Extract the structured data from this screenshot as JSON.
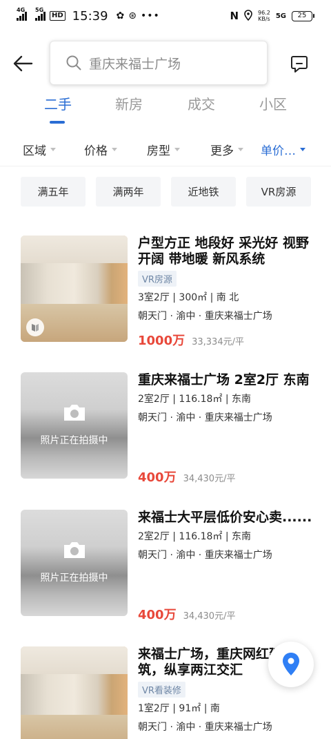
{
  "status_bar": {
    "sig1_tag": "4G",
    "sig2_tag": "5G",
    "hd": "HD",
    "time": "15:39",
    "net_speed": "96.2",
    "net_unit": "KB/s",
    "sig3_tag": "5G",
    "battery": "25"
  },
  "search": {
    "placeholder": "重庆来福士广场"
  },
  "tabs": [
    {
      "label": "二手",
      "active": true
    },
    {
      "label": "新房"
    },
    {
      "label": "成交"
    },
    {
      "label": "小区"
    }
  ],
  "filters": [
    {
      "label": "区域"
    },
    {
      "label": "价格"
    },
    {
      "label": "房型"
    },
    {
      "label": "更多"
    },
    {
      "label": "单价…",
      "active": true
    }
  ],
  "chips": [
    "满五年",
    "满两年",
    "近地铁",
    "VR房源"
  ],
  "listings": [
    {
      "title": "户型方正 地段好  采光好 视野开阔 带地暖 新风系统",
      "badge": "VR房源",
      "spec": "3室2厅 | 300㎡ | 南 北",
      "location": "朝天门 · 渝中 · 重庆来福士广场",
      "price": "1000万",
      "unit_price": "33,334元/平"
    },
    {
      "title": "重庆来福士广场 2室2厅 东南",
      "overlay": "照片正在拍摄中",
      "spec": "2室2厅 | 116.18㎡ | 东南",
      "location": "朝天门 · 渝中 · 重庆来福士广场",
      "price": "400万",
      "unit_price": "34,430元/平"
    },
    {
      "title": "来福士大平层低价安心卖......",
      "overlay": "照片正在拍摄中",
      "spec": "2室2厅 | 116.18㎡ | 东南",
      "location": "朝天门 · 渝中 · 重庆来福士广场",
      "price": "400万",
      "unit_price": "34,430元/平"
    },
    {
      "title": "来福士广场，重庆网红建筑，纵享两江交汇",
      "badge": "VR看装修",
      "spec": "1室2厅 | 91㎡ | 南",
      "location": "朝天门 · 渝中 · 重庆来福士广场"
    }
  ],
  "colors": {
    "accent": "#2a6dd4",
    "price": "#e8483a",
    "map_pin": "#2f7ff5"
  },
  "icons": [
    "back-arrow-icon",
    "search-icon",
    "message-icon",
    "vr-icon",
    "camera-icon",
    "map-pin-icon"
  ]
}
